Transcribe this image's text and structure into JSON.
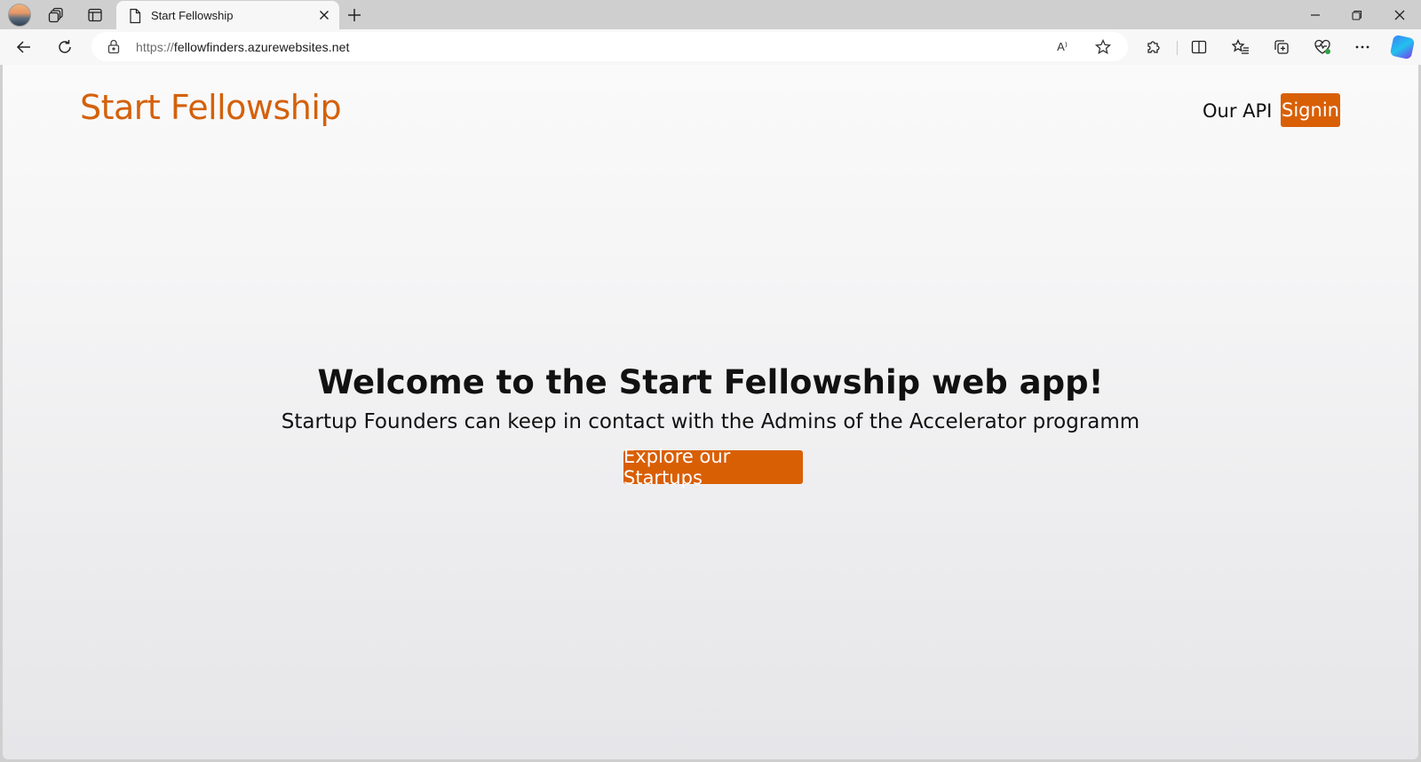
{
  "browser": {
    "tab": {
      "title": "Start Fellowship"
    },
    "address": {
      "scheme": "https://",
      "host": "fellowfinders.azurewebsites.net"
    },
    "read_aloud_label": "A⁾",
    "icons": {
      "profile": "profile-avatar",
      "workspaces": "workspaces-icon",
      "tab_actions": "vertical-tabs-icon",
      "page": "page-icon",
      "close_tab": "close-icon",
      "new_tab": "plus-icon",
      "minimize": "minimize-icon",
      "restore": "restore-icon",
      "close_window": "close-icon",
      "back": "back-arrow-icon",
      "refresh": "refresh-icon",
      "lock": "lock-icon",
      "read_aloud": "read-aloud-icon",
      "favorite": "star-icon",
      "extensions": "puzzle-icon",
      "split_screen": "split-screen-icon",
      "favorites": "favorites-icon",
      "collections": "collections-icon",
      "browser_essentials": "heart-pulse-icon",
      "more": "more-icon",
      "copilot": "copilot-icon"
    }
  },
  "site": {
    "brand": "Start Fellowship",
    "nav": {
      "api_label": "Our API",
      "signin_label": "Signin"
    },
    "hero": {
      "title": "Welcome to the Start Fellowship web app!",
      "subtitle": "Startup Founders can keep in contact with the Admins of the Accelerator programm",
      "cta_label": "Explore our Startups"
    },
    "colors": {
      "accent": "#d95f05",
      "brand_text": "#d4610b"
    }
  }
}
